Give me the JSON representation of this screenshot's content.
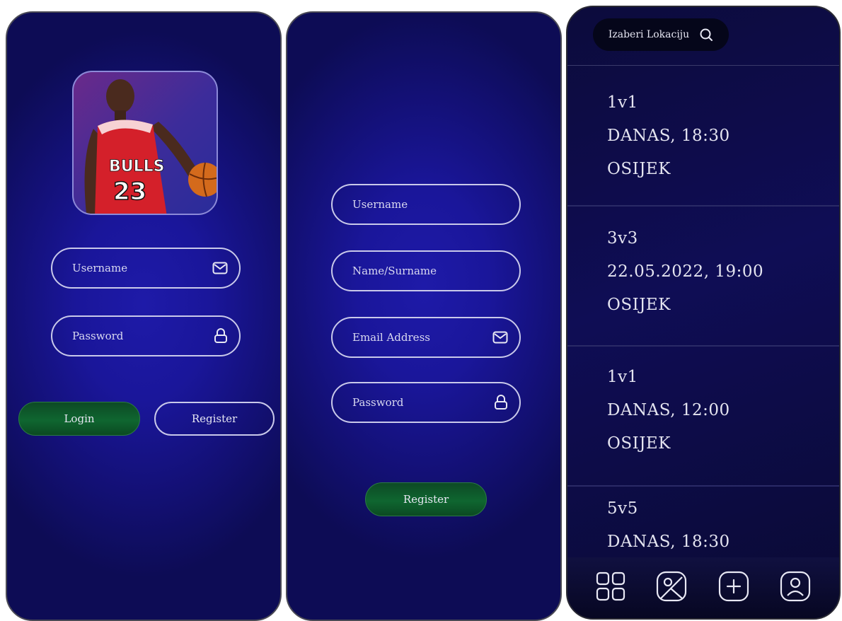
{
  "login": {
    "username_placeholder": "Username",
    "password_placeholder": "Password",
    "login_label": "Login",
    "register_label": "Register"
  },
  "register": {
    "username_placeholder": "Username",
    "name_placeholder": "Name/Surname",
    "email_placeholder": "Email Address",
    "password_placeholder": "Password",
    "register_label": "Register"
  },
  "events": {
    "location_label": "Izaberi Lokaciju",
    "items": [
      {
        "type": "1v1",
        "when": "DANAS, 18:30",
        "city": "OSIJEK"
      },
      {
        "type": "3v3",
        "when": "22.05.2022, 19:00",
        "city": "OSIJEK"
      },
      {
        "type": "1v1",
        "when": "DANAS, 12:00",
        "city": "OSIJEK"
      },
      {
        "type": "5v5",
        "when": "DANAS, 18:30"
      }
    ],
    "nav_icons": [
      "grid-icon",
      "map-icon",
      "add-icon",
      "profile-icon"
    ]
  },
  "colors": {
    "background_blue": "#1a169a",
    "button_green": "#0f6630",
    "outline": "#c9c9ea"
  }
}
